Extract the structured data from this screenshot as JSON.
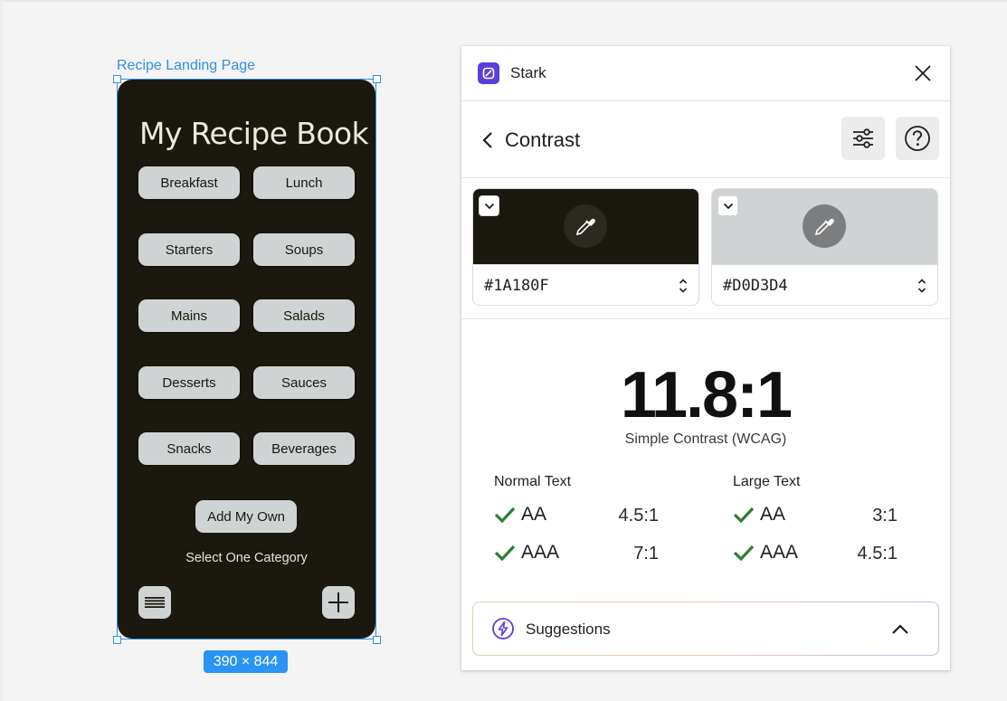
{
  "figma": {
    "frame_label": "Recipe Landing Page",
    "size_badge": "390 × 844"
  },
  "phone": {
    "title": "My Recipe Book",
    "categories": [
      "Breakfast",
      "Lunch",
      "Starters",
      "Soups",
      "Mains",
      "Salads",
      "Desserts",
      "Sauces",
      "Snacks",
      "Beverages"
    ],
    "add_button": "Add My Own",
    "helper_text": "Select One Category",
    "icons": {
      "left": "menu-icon",
      "right": "plus-icon"
    }
  },
  "stark": {
    "app_name": "Stark",
    "section_title": "Contrast",
    "foreground": {
      "hex": "#1A180F",
      "color": "#1a180f"
    },
    "background": {
      "hex": "#D0D3D4",
      "color": "#d0d3d4"
    },
    "ratio": "11.8:1",
    "ratio_label": "Simple Contrast (WCAG)",
    "normal_text": {
      "title": "Normal Text",
      "rows": [
        {
          "level": "AA",
          "requirement": "4.5:1",
          "pass": true
        },
        {
          "level": "AAA",
          "requirement": "7:1",
          "pass": true
        }
      ]
    },
    "large_text": {
      "title": "Large Text",
      "rows": [
        {
          "level": "AA",
          "requirement": "3:1",
          "pass": true
        },
        {
          "level": "AAA",
          "requirement": "4.5:1",
          "pass": true
        }
      ]
    },
    "suggestions_label": "Suggestions",
    "colors": {
      "brand": "#5b3fd9",
      "pass": "#2e7d32",
      "selection": "#2f8fe8"
    }
  }
}
